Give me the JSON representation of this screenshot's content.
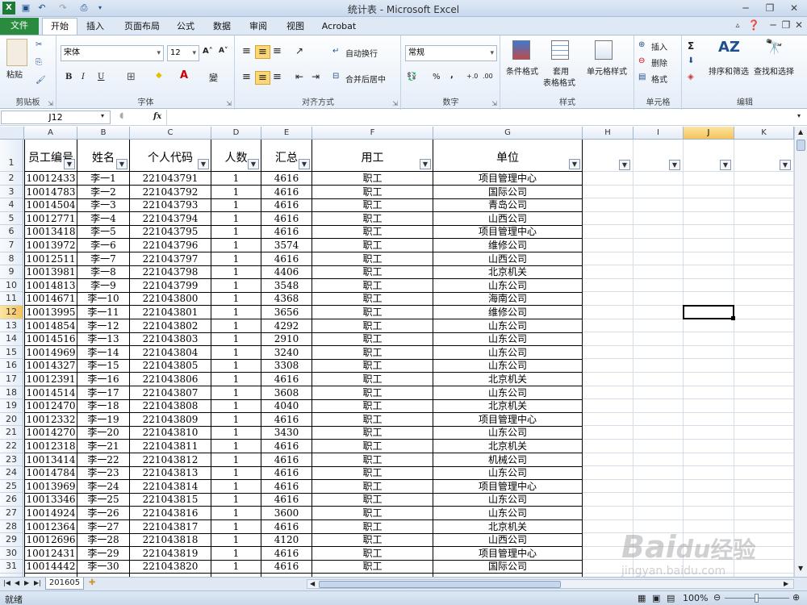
{
  "window": {
    "title": "统计表 - Microsoft Excel"
  },
  "tabs": [
    "文件",
    "开始",
    "插入",
    "页面布局",
    "公式",
    "数据",
    "审阅",
    "视图",
    "Acrobat"
  ],
  "ribbon": {
    "clipboard": {
      "paste": "粘贴",
      "group": "剪贴板"
    },
    "font": {
      "name": "宋体",
      "size": "12",
      "group": "字体",
      "bold": "B",
      "italic": "I",
      "underline": "U"
    },
    "alignment": {
      "wrap": "自动换行",
      "merge": "合并后居中",
      "group": "对齐方式"
    },
    "number": {
      "format": "常规",
      "percent": "%",
      "comma": ",",
      "group": "数字"
    },
    "styles": {
      "cond": "条件格式",
      "table1": "套用",
      "table2": "表格格式",
      "cell": "单元格样式",
      "group": "样式"
    },
    "cells": {
      "insert": "插入",
      "delete": "删除",
      "format": "格式",
      "group": "单元格"
    },
    "editing": {
      "sigma": "Σ",
      "sort": "排序和筛选",
      "find": "查找和选择",
      "group": "编辑"
    }
  },
  "formula_bar": {
    "name_box": "J12",
    "fx": "fx",
    "formula": ""
  },
  "columns": [
    "A",
    "B",
    "C",
    "D",
    "E",
    "F",
    "G",
    "H",
    "I",
    "J",
    "K"
  ],
  "headers": [
    "员工编号",
    "姓名",
    "个人代码",
    "人数",
    "汇总",
    "用工",
    "单位"
  ],
  "rows": [
    [
      "10012433",
      "李一1",
      "221043791",
      "1",
      "4616",
      "职工",
      "项目管理中心"
    ],
    [
      "10014783",
      "李一2",
      "221043792",
      "1",
      "4616",
      "职工",
      "国际公司"
    ],
    [
      "10014504",
      "李一3",
      "221043793",
      "1",
      "4616",
      "职工",
      "青岛公司"
    ],
    [
      "10012771",
      "李一4",
      "221043794",
      "1",
      "4616",
      "职工",
      "山西公司"
    ],
    [
      "10013418",
      "李一5",
      "221043795",
      "1",
      "4616",
      "职工",
      "项目管理中心"
    ],
    [
      "10013972",
      "李一6",
      "221043796",
      "1",
      "3574",
      "职工",
      "维修公司"
    ],
    [
      "10012511",
      "李一7",
      "221043797",
      "1",
      "4616",
      "职工",
      "山西公司"
    ],
    [
      "10013981",
      "李一8",
      "221043798",
      "1",
      "4406",
      "职工",
      "北京机关"
    ],
    [
      "10014813",
      "李一9",
      "221043799",
      "1",
      "3548",
      "职工",
      "山东公司"
    ],
    [
      "10014671",
      "李一10",
      "221043800",
      "1",
      "4368",
      "职工",
      "海南公司"
    ],
    [
      "10013995",
      "李一11",
      "221043801",
      "1",
      "3656",
      "职工",
      "维修公司"
    ],
    [
      "10014854",
      "李一12",
      "221043802",
      "1",
      "4292",
      "职工",
      "山东公司"
    ],
    [
      "10014516",
      "李一13",
      "221043803",
      "1",
      "2910",
      "职工",
      "山东公司"
    ],
    [
      "10014969",
      "李一14",
      "221043804",
      "1",
      "3240",
      "职工",
      "山东公司"
    ],
    [
      "10014327",
      "李一15",
      "221043805",
      "1",
      "3308",
      "职工",
      "山东公司"
    ],
    [
      "10012391",
      "李一16",
      "221043806",
      "1",
      "4616",
      "职工",
      "北京机关"
    ],
    [
      "10014514",
      "李一17",
      "221043807",
      "1",
      "3608",
      "职工",
      "山东公司"
    ],
    [
      "10012470",
      "李一18",
      "221043808",
      "1",
      "4040",
      "职工",
      "北京机关"
    ],
    [
      "10012332",
      "李一19",
      "221043809",
      "1",
      "4616",
      "职工",
      "项目管理中心"
    ],
    [
      "10014270",
      "李一20",
      "221043810",
      "1",
      "3430",
      "职工",
      "山东公司"
    ],
    [
      "10012318",
      "李一21",
      "221043811",
      "1",
      "4616",
      "职工",
      "北京机关"
    ],
    [
      "10013414",
      "李一22",
      "221043812",
      "1",
      "4616",
      "职工",
      "机械公司"
    ],
    [
      "10014784",
      "李一23",
      "221043813",
      "1",
      "4616",
      "职工",
      "山东公司"
    ],
    [
      "10013969",
      "李一24",
      "221043814",
      "1",
      "4616",
      "职工",
      "项目管理中心"
    ],
    [
      "10013346",
      "李一25",
      "221043815",
      "1",
      "4616",
      "职工",
      "山东公司"
    ],
    [
      "10014924",
      "李一26",
      "221043816",
      "1",
      "3600",
      "职工",
      "山东公司"
    ],
    [
      "10012364",
      "李一27",
      "221043817",
      "1",
      "4616",
      "职工",
      "北京机关"
    ],
    [
      "10012696",
      "李一28",
      "221043818",
      "1",
      "4120",
      "职工",
      "山西公司"
    ],
    [
      "10012431",
      "李一29",
      "221043819",
      "1",
      "4616",
      "职工",
      "项目管理中心"
    ],
    [
      "10014442",
      "李一30",
      "221043820",
      "1",
      "4616",
      "职工",
      "国际公司"
    ]
  ],
  "row_numbers": [
    "1",
    "2",
    "3",
    "4",
    "5",
    "6",
    "7",
    "8",
    "9",
    "10",
    "11",
    "12",
    "13",
    "14",
    "15",
    "16",
    "17",
    "18",
    "19",
    "20",
    "21",
    "22",
    "23",
    "24",
    "25",
    "26",
    "27",
    "28",
    "29",
    "30",
    "31"
  ],
  "sheet": {
    "name": "201605"
  },
  "status": {
    "ready": "就绪",
    "zoom": "100%"
  },
  "watermark": {
    "main": "Bai",
    "du": "du",
    "cn": "经验",
    "url": "jingyan.baidu.com"
  },
  "colors": {
    "file_tab": "#2a8a3e",
    "selection": "#f5c35d",
    "ribbon": "#e4edf8"
  }
}
